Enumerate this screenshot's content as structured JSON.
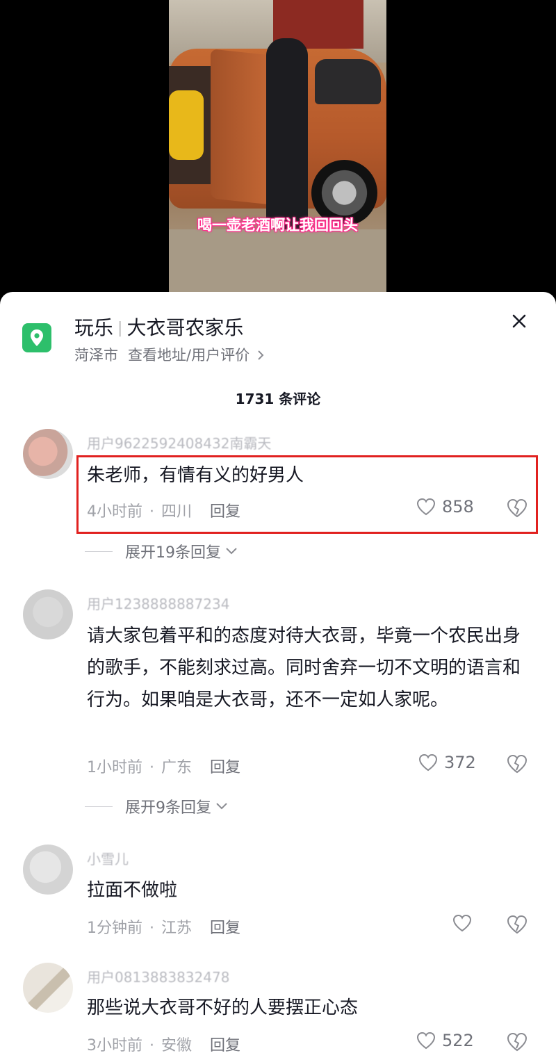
{
  "video": {
    "subtitle": "喝一壶老酒啊让我回回头"
  },
  "poi": {
    "category": "玩乐",
    "name": "大衣哥农家乐",
    "city": "菏泽市",
    "link": "查看地址/用户评价",
    "icon": "location-pin-icon",
    "icon_bg": "#2dbf6b"
  },
  "comments_header": {
    "count": "1731 条评论"
  },
  "comments": [
    {
      "username": "用户9622592408432南霸天",
      "text": "朱老师，有情有义的好男人",
      "time": "4小时前",
      "region": "四川",
      "reply": "回复",
      "likes": "858",
      "expand": "展开19条回复"
    },
    {
      "username": "用户1238888887234",
      "text": "请大家包着平和的态度对待大衣哥，毕竟一个农民出身的歌手，不能刻求过高。同时舍弃一切不文明的语言和行为。如果咱是大衣哥，还不一定如人家呢。",
      "time": "1小时前",
      "region": "广东",
      "reply": "回复",
      "likes": "372",
      "expand": "展开9条回复"
    },
    {
      "username": "小雪儿",
      "text": "拉面不做啦",
      "time": "1分钟前",
      "region": "江苏",
      "reply": "回复",
      "likes": ""
    },
    {
      "username": "用户0813883832478",
      "text": "那些说大衣哥不好的人要摆正心态",
      "time": "3小时前",
      "region": "安徽",
      "reply": "回复",
      "likes": "522"
    }
  ],
  "colors": {
    "highlight": "#e1211f",
    "text_primary": "#161823",
    "text_secondary": "#a0a2a8"
  }
}
